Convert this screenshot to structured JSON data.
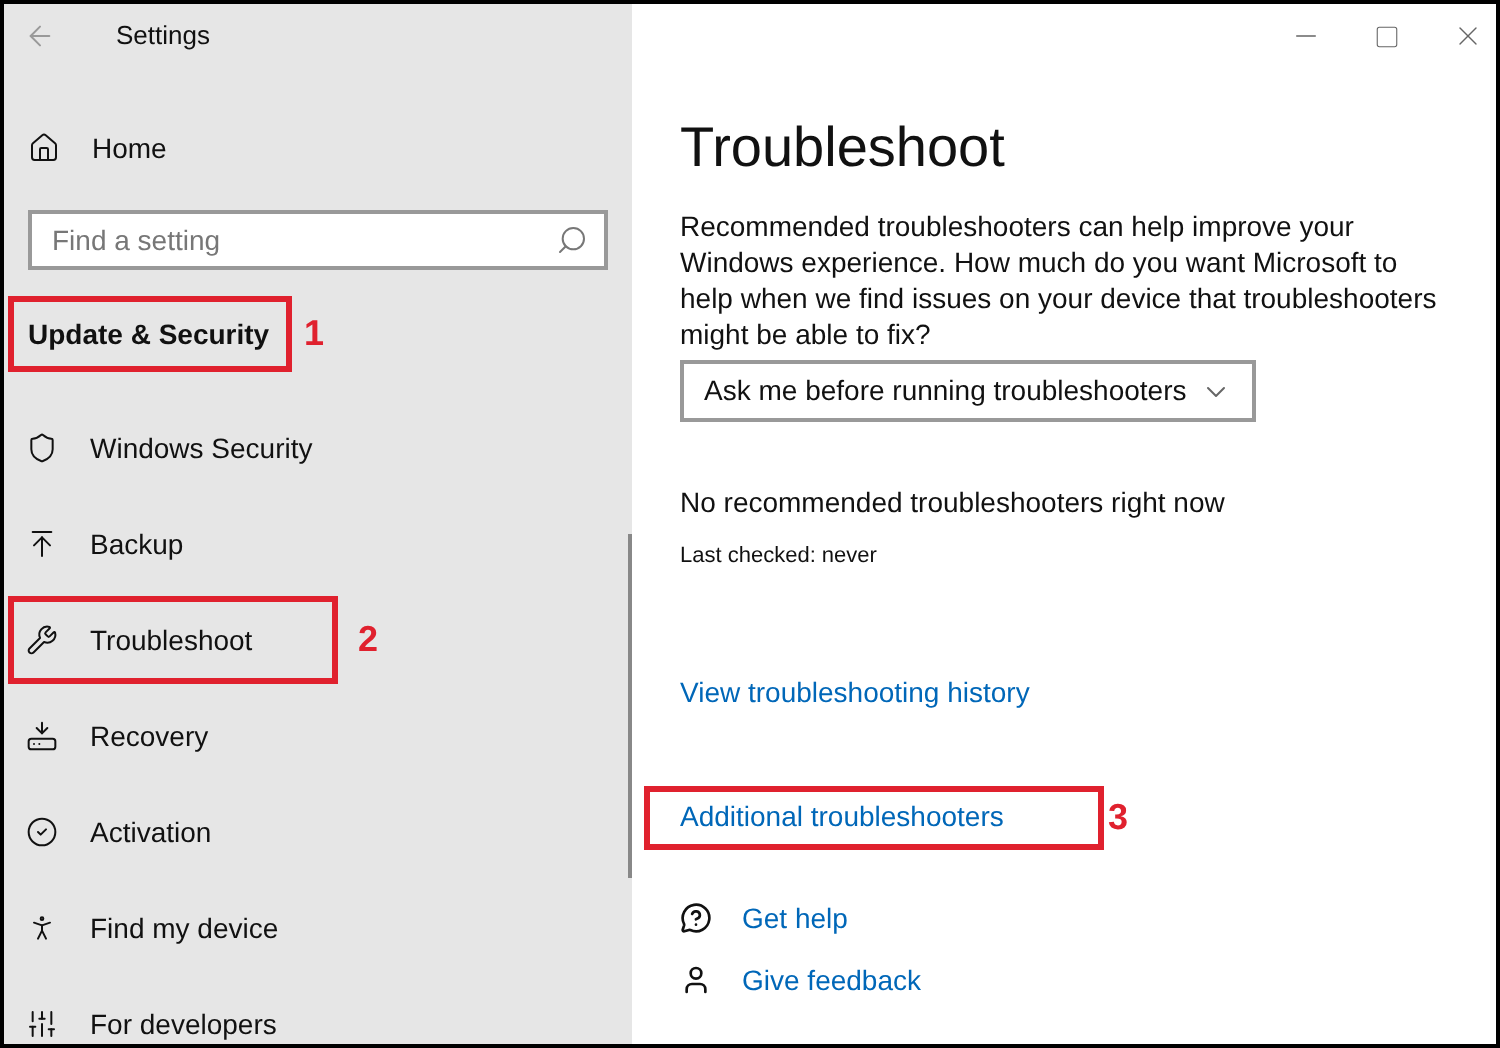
{
  "window": {
    "title": "Settings"
  },
  "sidebar": {
    "home": "Home",
    "search": {
      "placeholder": "Find a setting"
    },
    "section": {
      "title": "Update & Security",
      "annotation": "1"
    },
    "items": [
      {
        "kind": "shield",
        "label": "Windows Security"
      },
      {
        "kind": "backup",
        "label": "Backup"
      },
      {
        "kind": "wrench",
        "label": "Troubleshoot",
        "annotation": "2"
      },
      {
        "kind": "recovery",
        "label": "Recovery"
      },
      {
        "kind": "activation",
        "label": "Activation"
      },
      {
        "kind": "find",
        "label": "Find my device"
      },
      {
        "kind": "developers",
        "label": "For developers"
      }
    ]
  },
  "main": {
    "title": "Troubleshoot",
    "description": "Recommended troubleshooters can help improve your Windows experience. How much do you want Microsoft to help when we find issues on your device that troubleshooters might be able to fix?",
    "dropdown": {
      "value": "Ask me before running troubleshooters"
    },
    "status": "No recommended troubleshooters right now",
    "last_checked": "Last checked: never",
    "links": [
      {
        "label": "View troubleshooting history"
      },
      {
        "label": "Additional troubleshooters",
        "annotation": "3"
      }
    ],
    "help_links": [
      {
        "kind": "help",
        "label": "Get help"
      },
      {
        "kind": "feedback",
        "label": "Give feedback"
      }
    ]
  }
}
